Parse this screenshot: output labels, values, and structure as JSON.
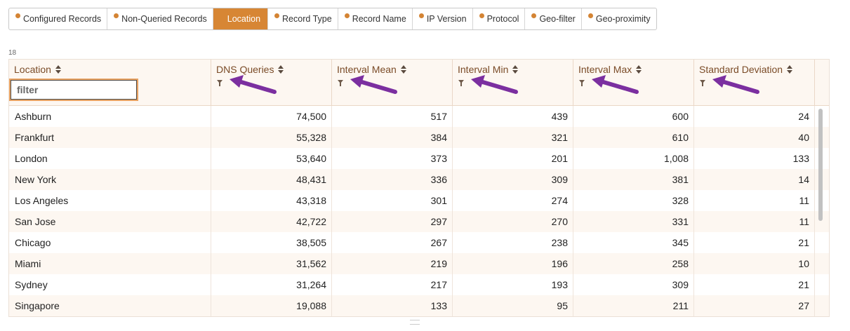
{
  "tabs": [
    {
      "label": "Configured Records",
      "active": false
    },
    {
      "label": "Non-Queried Records",
      "active": false
    },
    {
      "label": "Location",
      "active": true
    },
    {
      "label": "Record Type",
      "active": false
    },
    {
      "label": "Record Name",
      "active": false
    },
    {
      "label": "IP Version",
      "active": false
    },
    {
      "label": "Protocol",
      "active": false
    },
    {
      "label": "Geo-filter",
      "active": false
    },
    {
      "label": "Geo-proximity",
      "active": false
    }
  ],
  "row_count": "18",
  "columns": [
    {
      "label": "Location"
    },
    {
      "label": "DNS Queries"
    },
    {
      "label": "Interval Mean"
    },
    {
      "label": "Interval Min"
    },
    {
      "label": "Interval Max"
    },
    {
      "label": "Standard Deviation"
    }
  ],
  "filter_placeholder": "filter",
  "rows": [
    [
      "Ashburn",
      "74,500",
      "517",
      "439",
      "600",
      "24"
    ],
    [
      "Frankfurt",
      "55,328",
      "384",
      "321",
      "610",
      "40"
    ],
    [
      "London",
      "53,640",
      "373",
      "201",
      "1,008",
      "133"
    ],
    [
      "New York",
      "48,431",
      "336",
      "309",
      "381",
      "14"
    ],
    [
      "Los Angeles",
      "43,318",
      "301",
      "274",
      "328",
      "11"
    ],
    [
      "San Jose",
      "42,722",
      "297",
      "270",
      "331",
      "11"
    ],
    [
      "Chicago",
      "38,505",
      "267",
      "238",
      "345",
      "21"
    ],
    [
      "Miami",
      "31,562",
      "219",
      "196",
      "258",
      "10"
    ],
    [
      "Sydney",
      "31,264",
      "217",
      "193",
      "309",
      "21"
    ],
    [
      "Singapore",
      "19,088",
      "133",
      "95",
      "211",
      "27"
    ]
  ],
  "colors": {
    "accent": "#d78634",
    "header_text": "#7a4b27",
    "annotation_arrow": "#7b2fa0"
  }
}
